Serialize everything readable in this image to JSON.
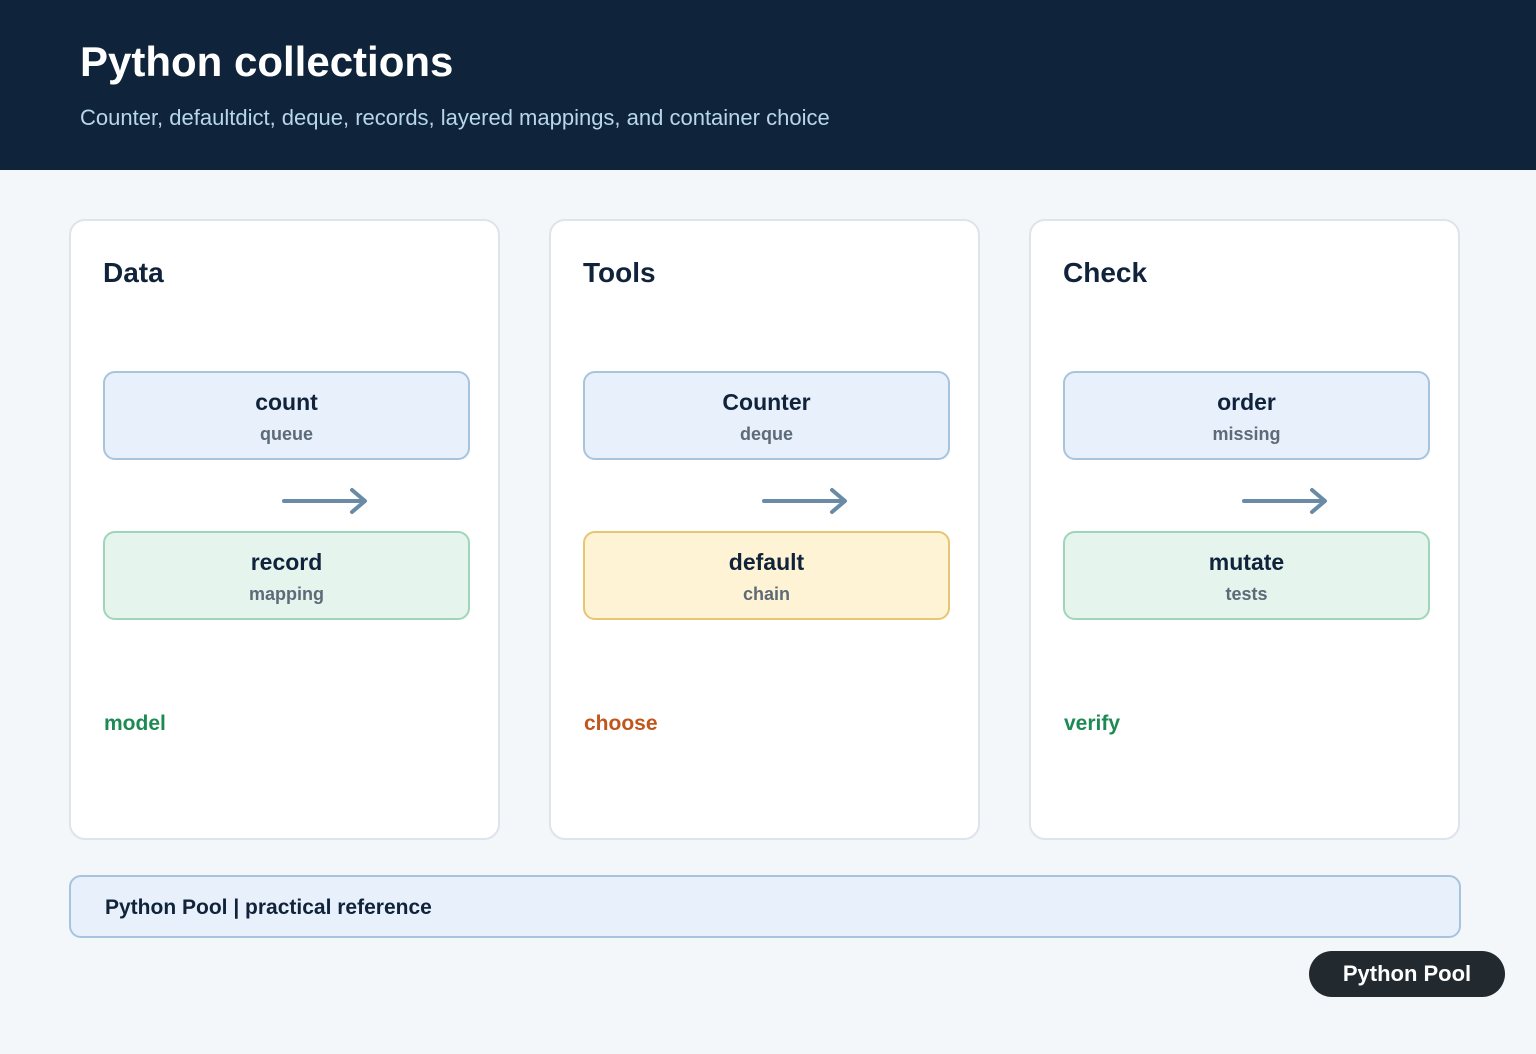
{
  "header": {
    "title": "Python collections",
    "subtitle": "Counter, defaultdict, deque, records, layered mappings, and container choice"
  },
  "colors": {
    "header_bg": "#0f233a",
    "page_bg": "#f3f7fa",
    "blue_box": "#e8f0fb",
    "green_box": "#e5f5ee",
    "yellow_box": "#fff3d6",
    "arrow": "#6a8aa5",
    "tag_green": "#1d8a55",
    "tag_orange": "#c0561c"
  },
  "panels": [
    {
      "title": "Data",
      "top_box": {
        "main": "count",
        "sub": "queue",
        "color": "blue"
      },
      "bottom_box": {
        "main": "record",
        "sub": "mapping",
        "color": "green"
      },
      "tag": {
        "label": "model",
        "color": "#1d8a55"
      }
    },
    {
      "title": "Tools",
      "top_box": {
        "main": "Counter",
        "sub": "deque",
        "color": "blue"
      },
      "bottom_box": {
        "main": "default",
        "sub": "chain",
        "color": "yellow"
      },
      "tag": {
        "label": "choose",
        "color": "#c0561c"
      }
    },
    {
      "title": "Check",
      "top_box": {
        "main": "order",
        "sub": "missing",
        "color": "blue"
      },
      "bottom_box": {
        "main": "mutate",
        "sub": "tests",
        "color": "green"
      },
      "tag": {
        "label": "verify",
        "color": "#1d8a55"
      }
    }
  ],
  "footer": {
    "text": "Python Pool | practical reference"
  },
  "badge": {
    "label": "Python Pool"
  }
}
